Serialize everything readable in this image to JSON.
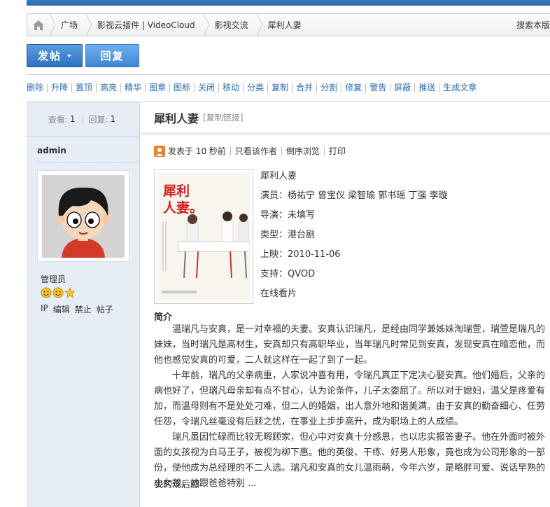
{
  "breadcrumb": {
    "items": [
      "广场",
      "影视云插件 | VideoCloud",
      "影视交流",
      "犀利人妻"
    ],
    "search_label": "搜索本版"
  },
  "actions": {
    "post_label": "发帖",
    "reply_label": "回复"
  },
  "mod_tools": [
    "删除",
    "升降",
    "置顶",
    "高亮",
    "精华",
    "图章",
    "图标",
    "关闭",
    "移动",
    "分类",
    "复制",
    "合并",
    "分割",
    "修复",
    "警告",
    "屏蔽",
    "推送",
    "生成文章"
  ],
  "sidebar": {
    "views_label": "查看:",
    "views": "1",
    "replies_label": "回复:",
    "replies": "1",
    "username": "admin",
    "role": "管理员",
    "user_links": [
      "IP",
      "编辑",
      "禁止",
      "帖子"
    ]
  },
  "thread": {
    "title": "犀利人妻",
    "copy_link": "[复制链接]"
  },
  "meta": {
    "posted": "发表于 10 秒前",
    "only_author": "只看该作者",
    "reverse": "倒序浏览",
    "print": "打印"
  },
  "poster_text": "犀利\n人妻。",
  "movie": {
    "name": "犀利人妻",
    "cast": "演员：杨祐宁 曾宝仪 梁智瑜 郭书瑶 丁强 李璇",
    "director": "导演：未填写",
    "genre": "类型：港台剧",
    "release": "上映：2010-11-06",
    "support": "支持：QVOD",
    "online": "在线看片"
  },
  "synopsis_heading": "简介",
  "synopsis": [
    "温瑞凡与安真，是一对幸福的夫妻。安真认识瑞凡，是经由同学兼姊妹淘瑞萱，瑞萱是瑞凡的妹妹，当时瑞凡是高材生，安真却只有高职毕业，当年瑞凡时常见到安真，发现安真在暗恋他，而他也感觉安真的可爱，二人就这样在一起了到了一起。",
    "十年前，瑞凡的父亲病重，人家说冲喜有用，令瑞凡真正下定决心娶安真。他们婚后，父亲的病也好了，但瑞凡母亲却有点不甘心，认为论条件，儿子太委屈了。所以对于媳妇，温父是疼爱有加，而温母则有不是处处刁难，但二人的婚姻，出人意外地和谐美满。由于安真的勤奋细心、任劳任怨，令瑞凡丝毫没有后顾之忧，在事业上步步高升，成为职场上的人成绩。",
    "瑞凡虽因忙碌而比较无暇顾家，但心中对安真十分感恩，也以忠实报答妻子。他在外面时被外面的女孩视为白马王子，被视为柳下惠。他的英俊、干练、好男人形象，竟也成为公司形象的一部份，使他成为总经理的不二人选。瑞凡和安真的女儿温雨萌，今年六岁，是略胖可爱、说话早熟的小女孩，她跟爸爸特别 ..."
  ],
  "after_text": "我的观后感",
  "colors": {
    "accent": "#2f72c0",
    "link": "#2a6ab5",
    "sidebar_bg": "#e6edf5",
    "border": "#c2d5e3"
  }
}
